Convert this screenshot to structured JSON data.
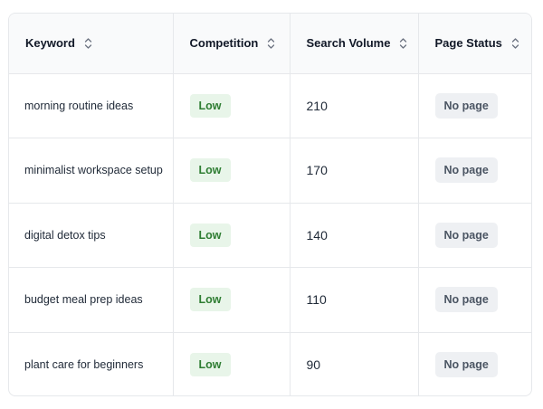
{
  "columns": {
    "keyword": "Keyword",
    "competition": "Competition",
    "search_volume": "Search Volume",
    "page_status": "Page Status",
    "sort_icon": "chevron-up-down-icon"
  },
  "rows": [
    {
      "keyword": "morning routine ideas",
      "competition": "Low",
      "volume": "210",
      "status": "No page"
    },
    {
      "keyword": "minimalist workspace setup",
      "competition": "Low",
      "volume": "170",
      "status": "No page"
    },
    {
      "keyword": "digital detox tips",
      "competition": "Low",
      "volume": "140",
      "status": "No page"
    },
    {
      "keyword": "budget meal prep ideas",
      "competition": "Low",
      "volume": "110",
      "status": "No page"
    },
    {
      "keyword": "plant care for beginners",
      "competition": "Low",
      "volume": "90",
      "status": "No page"
    }
  ],
  "colors": {
    "border": "#e6e8eb",
    "header_bg": "#f9fafb",
    "low_badge_bg": "#e8f5e9",
    "low_badge_text": "#2e7d32",
    "status_badge_bg": "#eef0f3",
    "status_badge_text": "#4b5563"
  }
}
